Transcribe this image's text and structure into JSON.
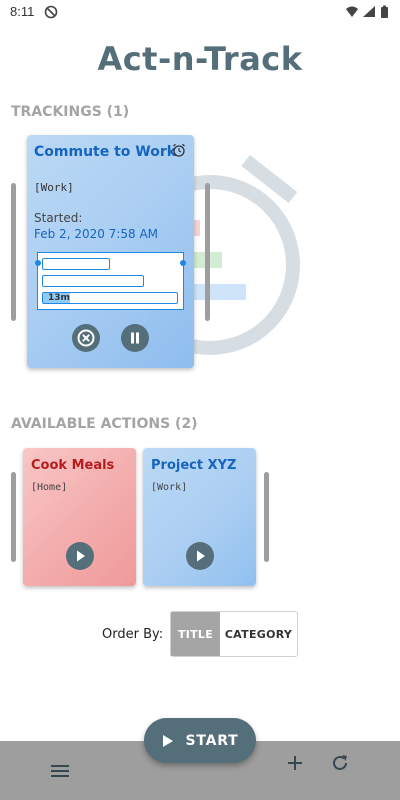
{
  "status_bar": {
    "time": "8:11",
    "icons": [
      "dnd-icon",
      "wifi-icon",
      "signal-icon",
      "battery-icon"
    ]
  },
  "app": {
    "title": "Act-n-Track"
  },
  "trackings": {
    "heading": "TRACKINGS (1)",
    "cards": [
      {
        "title": "Commute to Work",
        "category": "[Work]",
        "started_label": "Started:",
        "started_value": "Feb 2, 2020 7:58 AM",
        "progress_label": "13m",
        "progress_fraction": 0.2,
        "icons": [
          "alarm-icon",
          "cancel-icon",
          "pause-icon"
        ]
      }
    ]
  },
  "available_actions": {
    "heading": "AVAILABLE ACTIONS (2)",
    "cards": [
      {
        "title": "Cook Meals",
        "category": "[Home]",
        "color": "#ef9a9a",
        "icon": "play-icon"
      },
      {
        "title": "Project XYZ",
        "category": "[Work]",
        "color": "#90caf9",
        "icon": "play-icon"
      }
    ]
  },
  "order_by": {
    "label": "Order By:",
    "options": [
      "TITLE",
      "CATEGORY"
    ],
    "selected": "TITLE"
  },
  "bottom_bar": {
    "icons": [
      "menu-icon",
      "add-icon",
      "refresh-icon"
    ]
  },
  "fab": {
    "label": "START",
    "icon": "play-icon"
  },
  "colors": {
    "accent": "#546e7a",
    "title_blue": "#1565c0",
    "title_red": "#b71c1c",
    "bar_gray": "#9e9e9e"
  }
}
